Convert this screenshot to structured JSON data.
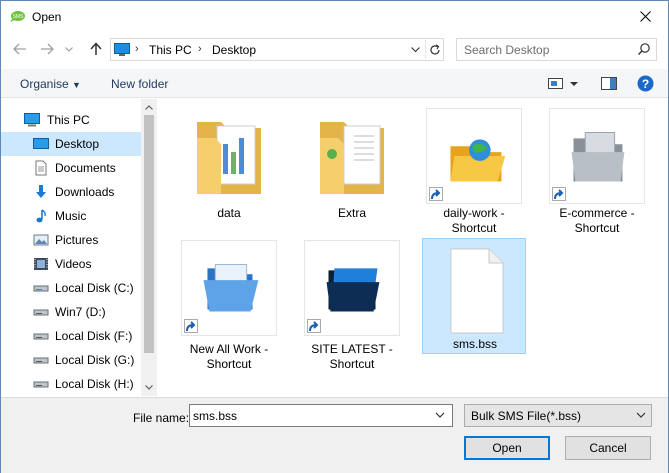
{
  "window": {
    "title": "Open",
    "app_icon": "sms-app-icon",
    "close_icon": "close-icon"
  },
  "nav": {
    "back_icon": "back-arrow-icon",
    "forward_icon": "forward-arrow-icon",
    "recent_icon": "chevron-down-icon",
    "up_icon": "up-arrow-icon",
    "breadcrumb": [
      "This PC",
      "Desktop"
    ],
    "search_placeholder": "Search Desktop"
  },
  "toolbar": {
    "organise": "Organise",
    "new_folder": "New folder"
  },
  "sidebar": {
    "items": [
      {
        "label": "This PC",
        "icon": "pc-icon",
        "level": 0
      },
      {
        "label": "Desktop",
        "icon": "desktop-icon",
        "level": 1,
        "selected": true
      },
      {
        "label": "Documents",
        "icon": "documents-icon",
        "level": 1
      },
      {
        "label": "Downloads",
        "icon": "downloads-icon",
        "level": 1
      },
      {
        "label": "Music",
        "icon": "music-icon",
        "level": 1
      },
      {
        "label": "Pictures",
        "icon": "pictures-icon",
        "level": 1
      },
      {
        "label": "Videos",
        "icon": "videos-icon",
        "level": 1
      },
      {
        "label": "Local Disk (C:)",
        "icon": "drive-icon",
        "level": 1
      },
      {
        "label": "Win7 (D:)",
        "icon": "drive-icon",
        "level": 1
      },
      {
        "label": "Local Disk (F:)",
        "icon": "drive-icon",
        "level": 1
      },
      {
        "label": "Local Disk (G:)",
        "icon": "drive-icon",
        "level": 1
      },
      {
        "label": "Local Disk (H:)",
        "icon": "drive-icon",
        "level": 1
      }
    ]
  },
  "files": {
    "data": "data",
    "extra": "Extra",
    "daily_work": "daily-work - Shortcut",
    "ecommerce": "E-commerce - Shortcut",
    "new_all_work": "New All Work - Shortcut",
    "site_latest": "SITE LATEST - Shortcut",
    "sms_bss": "sms.bss"
  },
  "footer": {
    "file_name_label": "File name:",
    "file_name_value": "sms.bss",
    "file_type": "Bulk SMS File(*.bss)",
    "open": "Open",
    "cancel": "Cancel"
  },
  "colors": {
    "selection": "#cce8ff",
    "accent": "#0078d7",
    "folder": "#f4cf6b"
  }
}
